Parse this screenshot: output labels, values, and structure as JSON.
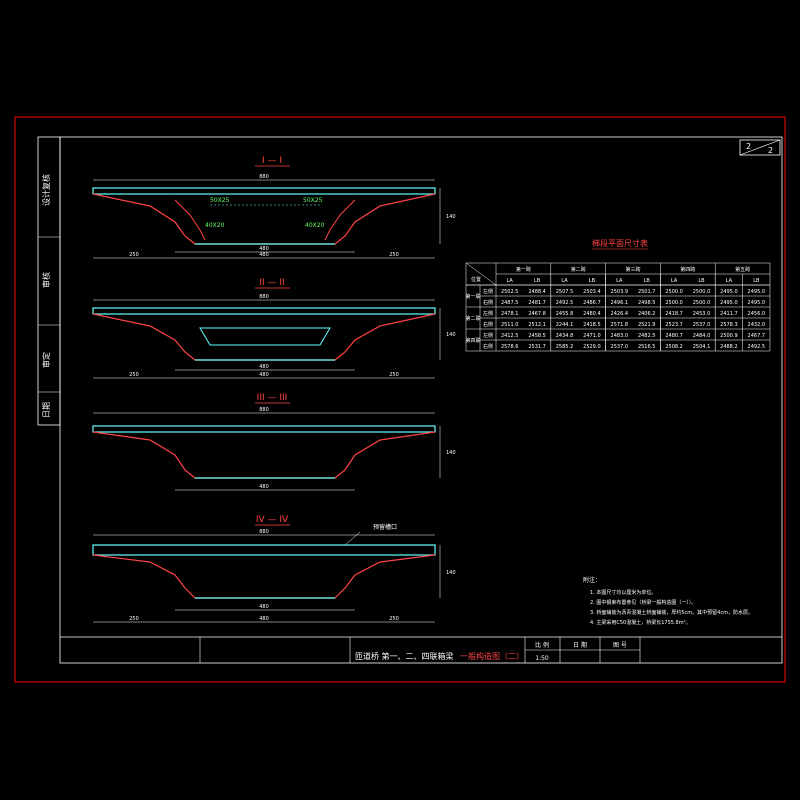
{
  "colors": {
    "frame": "#ff0000",
    "deck": "#66ffff",
    "dimension": "#ffffff",
    "section_title": "#ff4444",
    "inner_label": "#66ff66",
    "table_title": "#ff4444"
  },
  "sections": [
    {
      "title": "I — I",
      "overall_width": "880",
      "left_flange_height": "15",
      "right_flange_height": "15",
      "web_slope_left": "ↄ",
      "web_slope_right": "ↄ",
      "top_center_dim": "30",
      "bottom_total": [
        "250",
        "480",
        "250"
      ],
      "bottom_center": "480",
      "cell_labels": [
        "50X25",
        "50X25",
        "40X20",
        "40X20"
      ],
      "side_height": "140"
    },
    {
      "title": "II — II",
      "overall_width": "880",
      "top_center_dim": "30",
      "bottom_total": [
        "250",
        "480",
        "250"
      ],
      "bottom_center": "480",
      "side_height": "140"
    },
    {
      "title": "III — III",
      "overall_width": "880",
      "bottom_center": "480",
      "side_height": "140"
    },
    {
      "title": "IV — IV",
      "overall_width": "880",
      "bottom_total": [
        "250",
        "480",
        "250"
      ],
      "bottom_center": "480",
      "callout": "预留槽口",
      "side_height": "140"
    }
  ],
  "table": {
    "title": "梯段平面尺寸表",
    "header_row1": [
      "位置",
      "第一跨",
      "第二跨",
      "第三跨",
      "第四跨",
      "第五跨"
    ],
    "header_row2": [
      "LA",
      "LB",
      "LA",
      "LB",
      "LA",
      "LB",
      "LA",
      "LB",
      "LA",
      "LB"
    ],
    "groups": [
      {
        "name": "第一联",
        "rows": [
          {
            "label": "左侧",
            "values": [
              "2502.5",
              "2488.4",
              "2507.5",
              "2503.4",
              "2503.9",
              "2501.7",
              "2500.0",
              "2500.0",
              "2495.0",
              "2495.0"
            ]
          },
          {
            "label": "右侧",
            "values": [
              "2487.5",
              "2481.7",
              "2492.5",
              "2486.7",
              "2496.1",
              "2498.5",
              "2500.0",
              "2500.0",
              "2495.0",
              "2495.0"
            ]
          }
        ]
      },
      {
        "name": "第二联",
        "rows": [
          {
            "label": "左侧",
            "values": [
              "2478.1",
              "2467.8",
              "2455.8",
              "2480.4",
              "2426.4",
              "2406.2",
              "2418.7",
              "2453.0",
              "2411.7",
              "2456.0"
            ]
          },
          {
            "label": "右侧",
            "values": [
              "2511.0",
              "2512.1",
              "2244.1",
              "2418.5",
              "2571.8",
              "2521.9",
              "2523.7",
              "2537.0",
              "2578.3",
              "2432.0"
            ]
          }
        ]
      },
      {
        "name": "第四联",
        "rows": [
          {
            "label": "左侧",
            "values": [
              "2412.5",
              "2458.5",
              "2434.8",
              "2471.0",
              "2483.0",
              "2482.5",
              "2480.7",
              "2484.0",
              "2500.9",
              "2467.7"
            ]
          },
          {
            "label": "右侧",
            "values": [
              "2578.6",
              "2531.7",
              "2585.2",
              "2529.0",
              "2537.0",
              "2516.5",
              "2508.2",
              "2504.1",
              "2488.2",
              "2492.5"
            ]
          }
        ]
      }
    ]
  },
  "notes": {
    "heading": "附注：",
    "items": [
      "1. 本图尺寸均以厘米为单位。",
      "2. 图中钢束布置参见（桥梁一般构造图（一））。",
      "3. 桥面铺装为沥青混凝土桥面铺装，厚约5cm。其中预留4cm，防水层。",
      "4. 主梁采用C50混凝土，桥梁长1755.8m²。"
    ]
  },
  "left_strip": [
    "设计复核",
    "审核",
    "审定",
    "日期"
  ],
  "title_block": {
    "project": "匝道桥 第一、二、四联箱梁",
    "drawing": "一般构造图（二）",
    "scale_label": "比 例",
    "scale_value": "1:50",
    "date_label": "日 期",
    "sheet_label": "图 号"
  },
  "sheet_number": {
    "current": "2",
    "total": "2"
  }
}
